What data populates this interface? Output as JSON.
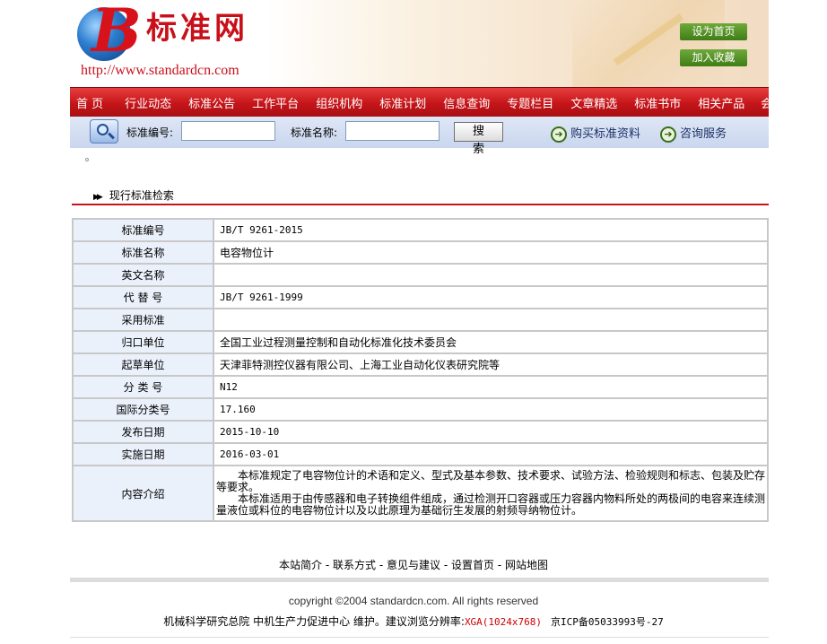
{
  "header": {
    "logo_text": "标准网",
    "logo_letter": "B",
    "url": "http://www.standardcn.com",
    "set_home": "设为首页",
    "add_favorite": "加入收藏"
  },
  "nav": [
    "首 页",
    "行业动态",
    "标准公告",
    "工作平台",
    "组织机构",
    "标准计划",
    "信息查询",
    "专题栏目",
    "文章精选",
    "标准书市",
    "相关产品",
    "会议直播"
  ],
  "search": {
    "code_label": "标准编号:",
    "name_label": "标准名称:",
    "button": "搜 索",
    "buy": "购买标准资料",
    "consult": "咨询服务"
  },
  "section_title": "现行标准检索",
  "detail": {
    "rows": [
      {
        "key": "标准编号",
        "value": "JB/T 9261-2015"
      },
      {
        "key": "标准名称",
        "value": "电容物位计"
      },
      {
        "key": "英文名称",
        "value": ""
      },
      {
        "key": "代 替 号",
        "value": "JB/T 9261-1999"
      },
      {
        "key": "采用标准",
        "value": ""
      },
      {
        "key": "归口单位",
        "value": "全国工业过程测量控制和自动化标准化技术委员会"
      },
      {
        "key": "起草单位",
        "value": "天津菲特测控仪器有限公司、上海工业自动化仪表研究院等"
      },
      {
        "key": "分 类 号",
        "value": "N12"
      },
      {
        "key": "国际分类号",
        "value": "17.160"
      },
      {
        "key": "发布日期",
        "value": "2015-10-10"
      },
      {
        "key": "实施日期",
        "value": "2016-03-01"
      }
    ],
    "intro_key": "内容介绍",
    "intro_p1": "本标准规定了电容物位计的术语和定义、型式及基本参数、技术要求、试验方法、检验规则和标志、包装及贮存等要求。",
    "intro_p2": "本标准适用于由传感器和电子转换组件组成，通过检测开口容器或压力容器内物料所处的两极间的电容来连续测量液位或料位的电容物位计以及以此原理为基础衍生发展的射频导纳物位计。"
  },
  "footer": {
    "links": [
      "本站简介",
      "联系方式",
      "意见与建议",
      "设置首页",
      "网站地图"
    ],
    "separator": " - ",
    "copyright": "copyright ©2004 standardcn.com. All rights reserved",
    "maintained": "机械科学研究总院 中机生产力促进中心 维护。建议浏览分辨率:",
    "resolution": "XGA(1024x768)",
    "icp": "京ICP备05033993号-27"
  },
  "colors": {
    "brand_red": "#c5151a",
    "nav_text": "#ffffff",
    "table_key_bg": "#ebf1fb",
    "button_green": "#4f8b22"
  }
}
